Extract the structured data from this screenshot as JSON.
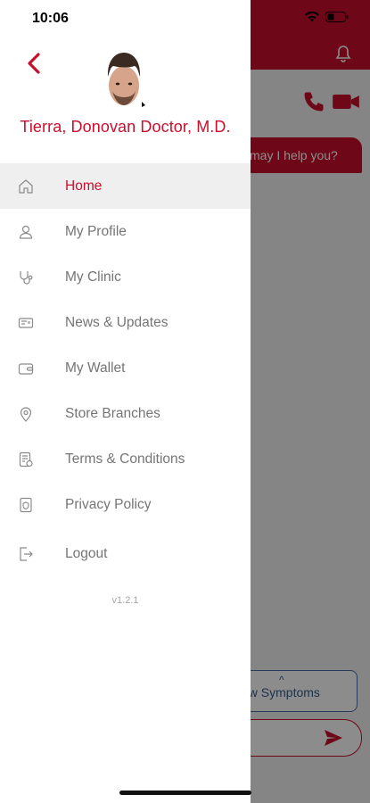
{
  "status_bar": {
    "time": "10:06"
  },
  "doctor": {
    "name": "Tierra, Donovan Doctor, M.D."
  },
  "menu": [
    {
      "label": "Home",
      "icon": "home-icon",
      "active": true
    },
    {
      "label": "My Profile",
      "icon": "user-icon",
      "active": false
    },
    {
      "label": "My Clinic",
      "icon": "stethoscope-icon",
      "active": false
    },
    {
      "label": "News & Updates",
      "icon": "newspaper-icon",
      "active": false
    },
    {
      "label": "My Wallet",
      "icon": "wallet-icon",
      "active": false
    },
    {
      "label": "Store Branches",
      "icon": "location-pin-icon",
      "active": false
    },
    {
      "label": "Terms & Conditions",
      "icon": "document-check-icon",
      "active": false
    },
    {
      "label": "Privacy Policy",
      "icon": "shield-document-icon",
      "active": false
    }
  ],
  "logout": {
    "label": "Logout",
    "icon": "logout-icon"
  },
  "version": "v1.2.1",
  "background_chat": {
    "bubble_text": "may I help you?",
    "symptoms_button": "ow Symptoms"
  },
  "colors": {
    "accent": "#c8102e",
    "inactive_text": "#757575",
    "active_bg": "#efefef"
  }
}
